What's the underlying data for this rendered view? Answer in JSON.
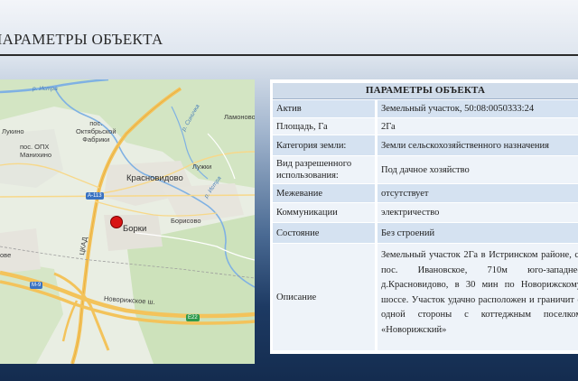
{
  "header": {
    "title": "ПАРАМЕТРЫ ОБЪЕКТА"
  },
  "map": {
    "labels": {
      "r_istra_top": "р. Истра",
      "r_istra_mid": "р. Истра",
      "r_sinichka": "р. Синичка",
      "lamonovo": "Ламоново",
      "oktyabrskoy_fabriki": "пос.\nОктябрьской\nФабрики",
      "lukino": "Лукино",
      "opkh_manikhino": "пос. ОПХ\nМанихино",
      "krasnovidovo": "Красновидово",
      "luzhki": "Лужки",
      "borisovo": "Борисово",
      "borki": "Борки",
      "tskad": "ЦКАД",
      "novorizhskoe": "Новорижское ш.",
      "ove": "ове"
    },
    "shields": {
      "a113": "А-113",
      "m9": "М-9",
      "e22": "Е22"
    },
    "colors": {
      "marker": "#d81414",
      "road": "#f3c35b",
      "river": "#7fb1e3",
      "forest": "#cfe3bd"
    }
  },
  "panel": {
    "heading": "ПАРАМЕТРЫ ОБЪЕКТА",
    "rows": [
      {
        "key": "Актив",
        "value": "Земельный участок, 50:08:0050333:24"
      },
      {
        "key": "Площадь, Га",
        "value": "2Га"
      },
      {
        "key": "Категория земли:",
        "value": "Земли сельскохозяйственного назначения"
      },
      {
        "key": "Вид разрешенного использования:",
        "value": "Под дачное хозяйство"
      },
      {
        "key": "Межевание",
        "value": "отсутствует"
      },
      {
        "key": "Коммуникации",
        "value": "электричество"
      },
      {
        "key": "Состояние",
        "value": "Без строений"
      },
      {
        "key": "Описание",
        "value": "Земельный участок 2Га в Истринском районе, с/пос. Ивановское, 710м юго-западнее д.Красновидово, в 30 мин по Новорижскому шоссе. Участок удачно расположен и граничит с одной стороны с коттеджным поселком «Новорижский»"
      }
    ]
  }
}
